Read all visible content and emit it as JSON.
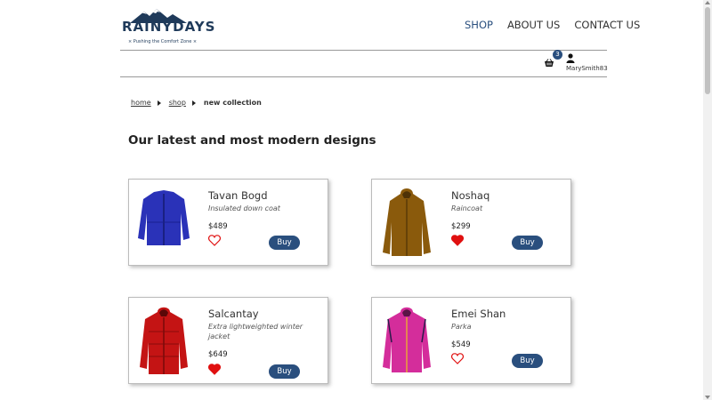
{
  "brand": {
    "name": "RAINYDAYS",
    "tagline": "⨯ Pushing the Comfort Zone ⨯",
    "color": "#1f3a5a"
  },
  "nav": {
    "items": [
      {
        "label": "SHOP",
        "active": true
      },
      {
        "label": "ABOUT US",
        "active": false
      },
      {
        "label": "CONTACT US",
        "active": false
      }
    ]
  },
  "cart": {
    "icon": "basket-icon",
    "count": "3"
  },
  "user": {
    "icon": "user-icon",
    "name": "MarySmith83"
  },
  "breadcrumb": {
    "items": [
      "home",
      "shop"
    ],
    "current": "new collection"
  },
  "heading": "Our latest and most modern designs",
  "accent_color": "#2a4f7e",
  "products": [
    {
      "name": "Tavan Bogd",
      "description": "Insulated down coat",
      "price": "$489",
      "favorite": false,
      "buy_label": "Buy",
      "color": "#2a32b8",
      "style": "jacket"
    },
    {
      "name": "Noshaq",
      "description": "Raincoat",
      "price": "$299",
      "favorite": true,
      "buy_label": "Buy",
      "color": "#8a5a0c",
      "style": "parka-hood"
    },
    {
      "name": "Salcantay",
      "description": "Extra lightweighted winter jacket",
      "price": "$649",
      "favorite": true,
      "buy_label": "Buy",
      "color": "#c41414",
      "style": "puffer"
    },
    {
      "name": "Emei Shan",
      "description": "Parka",
      "price": "$549",
      "favorite": false,
      "buy_label": "Buy",
      "color": "#d42d9b",
      "style": "parka"
    }
  ]
}
